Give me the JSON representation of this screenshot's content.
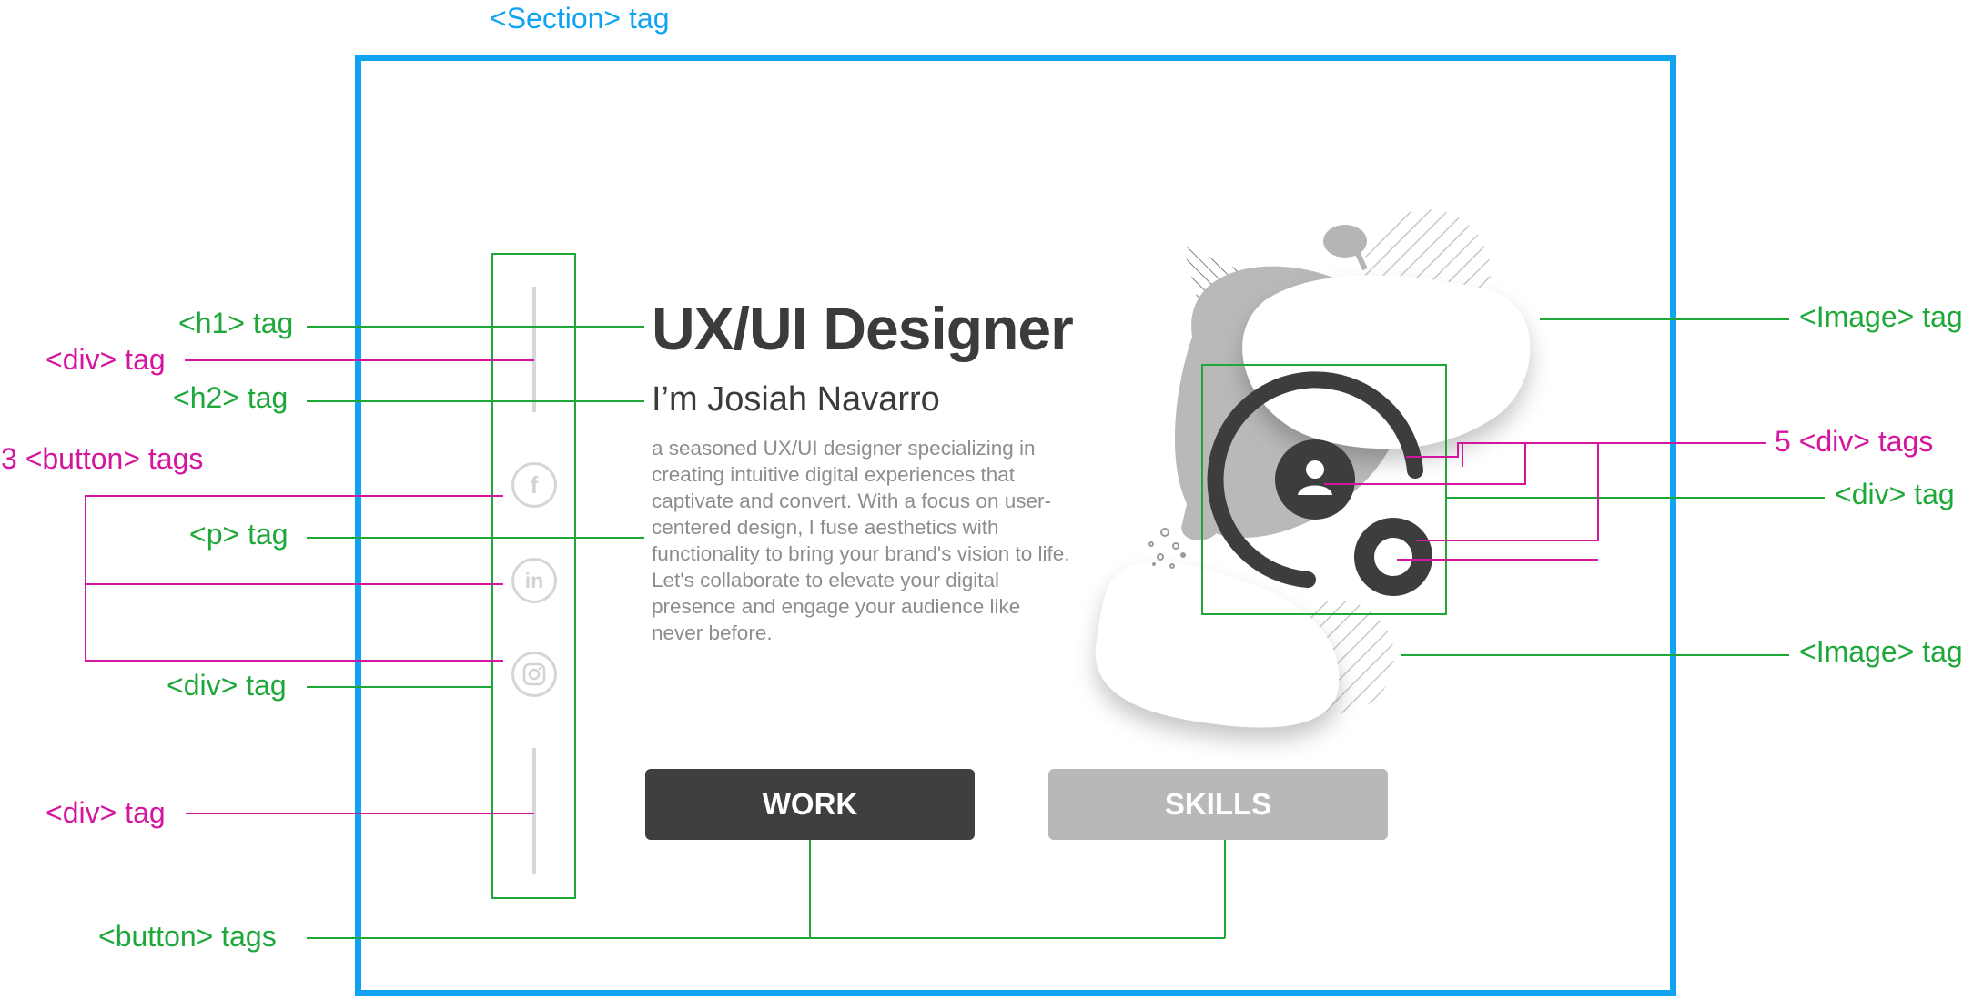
{
  "annotations": {
    "section": "<Section> tag",
    "h1": "<h1> tag",
    "div_top_line": "<div> tag",
    "h2": "<h2> tag",
    "three_buttons": "3 <button> tags",
    "p": "<p> tag",
    "div_social": "<div> tag",
    "div_bottom_line": "<div> tag",
    "buttons": "<button> tags",
    "image_top": "<Image> tag",
    "five_divs": "5 <div> tags",
    "div_icon": "<div> tag",
    "image_bottom": "<Image> tag"
  },
  "hero": {
    "title": "UX/UI Designer",
    "subtitle": "I’m Josiah Navarro",
    "paragraph": "a seasoned UX/UI designer specializing in creating intuitive digital experiences that captivate and convert. With a focus on user-centered design, I fuse aesthetics with functionality to bring your brand's vision to life. Let's collaborate to elevate your digital presence and engage your audience like never before."
  },
  "buttons": {
    "work": "WORK",
    "skills": "SKILLS"
  },
  "social_icons": [
    "facebook-icon",
    "linkedin-icon",
    "instagram-icon"
  ],
  "colors": {
    "annotation_green": "#1fa83a",
    "annotation_magenta": "#d4169f",
    "section_blue": "#10a3f2",
    "dark": "#3b3b3b",
    "light_gray": "#bdbdbd"
  }
}
